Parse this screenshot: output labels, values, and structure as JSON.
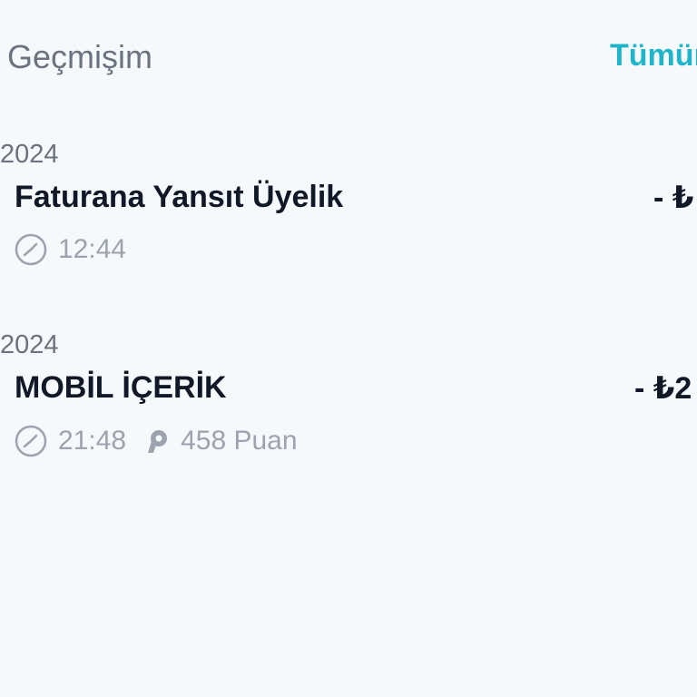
{
  "header": {
    "title": "Geçmişim",
    "see_all_label": "Tümün"
  },
  "transactions": [
    {
      "date": "2024",
      "title": "Faturana Yansıt Üyelik",
      "amount": "- ₺",
      "time": "12:44",
      "points": null
    },
    {
      "date": "2024",
      "title": "MOBİL İÇERİK",
      "amount": "- ₺2",
      "time": "21:48",
      "points": "458 Puan"
    }
  ],
  "icons": {
    "clock": "clock-icon",
    "points": "points-icon"
  },
  "colors": {
    "background": "#f6f9fc",
    "accent": "#1eb4c9",
    "primary_text": "#111827",
    "secondary_text": "#6b7280",
    "muted_text": "#9ca3af"
  }
}
